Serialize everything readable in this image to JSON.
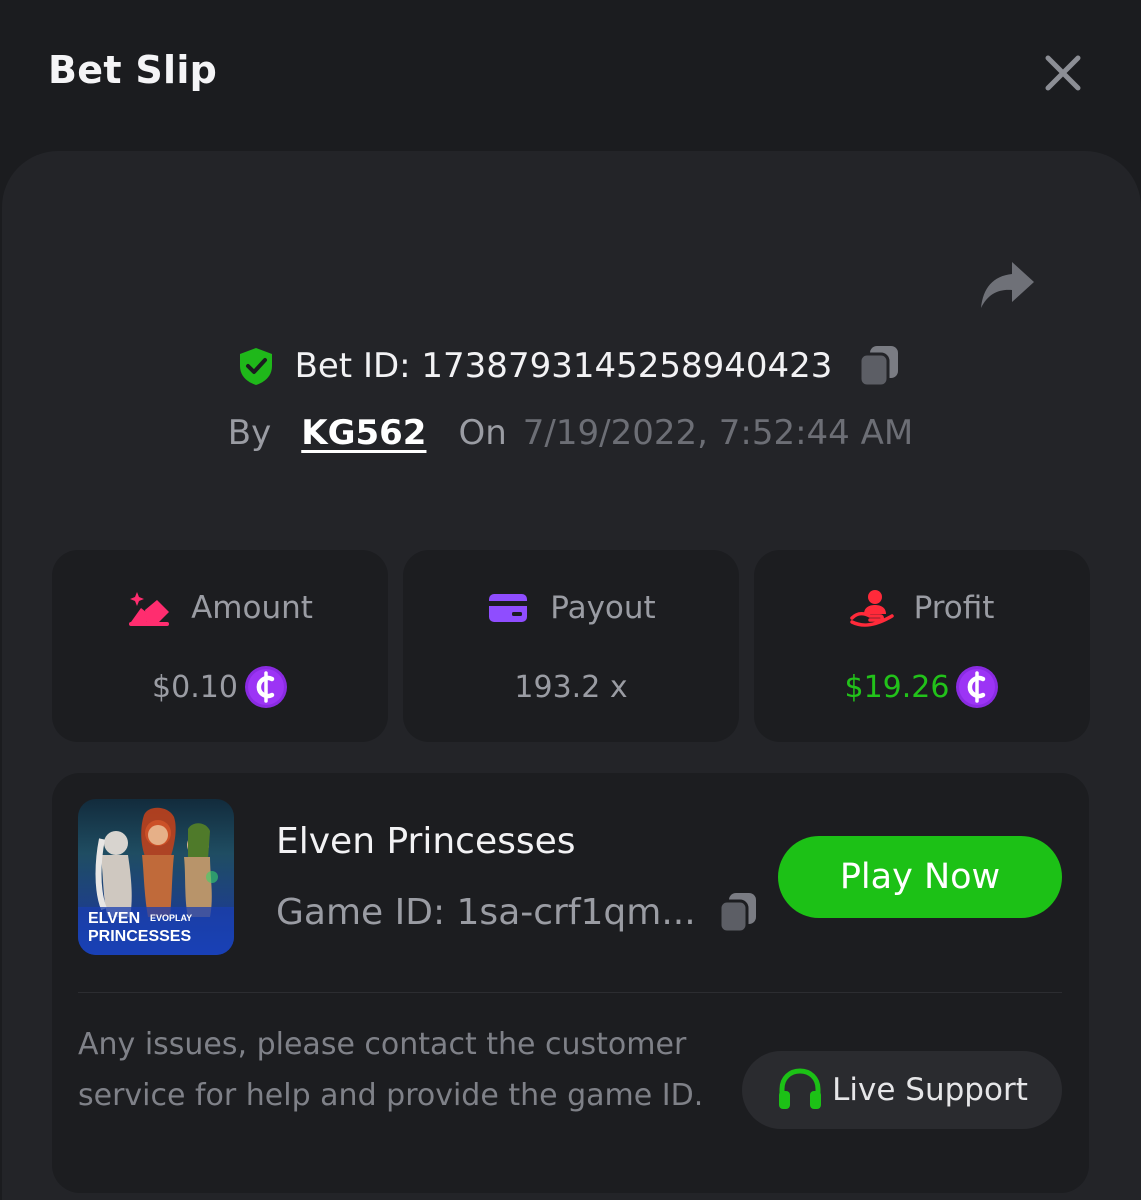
{
  "header": {
    "title": "Bet Slip"
  },
  "bet": {
    "id_text": "Bet ID: 1738793145258940423",
    "by_label": "By",
    "user": "KG562",
    "on_label": "On",
    "datetime": "7/19/2022, 7:52:44 AM"
  },
  "stats": [
    {
      "label": "Amount",
      "value": "$0.10",
      "icon": "coins-stack-icon",
      "has_coin": true,
      "color": "#9a9ca3"
    },
    {
      "label": "Payout",
      "value": "193.2 x",
      "icon": "wallet-card-icon",
      "has_coin": false,
      "color": "#9a9ca3"
    },
    {
      "label": "Profit",
      "value": "$19.26",
      "icon": "hand-profit-icon",
      "has_coin": true,
      "color": "#22c21a"
    }
  ],
  "game": {
    "name": "Elven Princesses",
    "id_text": "Game ID: 1sa-crf1qm...",
    "thumb_line1": "ELVEN",
    "thumb_brand": "EVOPLAY",
    "thumb_line2": "PRINCESSES",
    "play_label": "Play Now"
  },
  "support": {
    "help_text": "Any issues, please contact the customer service for help and provide the game ID.",
    "button_label": "Live Support"
  },
  "colors": {
    "background": "#1b1c1f",
    "panel": "#232428",
    "card": "#1c1d20",
    "accent_green": "#1cc116",
    "coin_purple": "#8a2be2",
    "amount_icon": "#ff2d6f",
    "payout_icon": "#8f4dff",
    "profit_icon": "#ff2a3a"
  }
}
